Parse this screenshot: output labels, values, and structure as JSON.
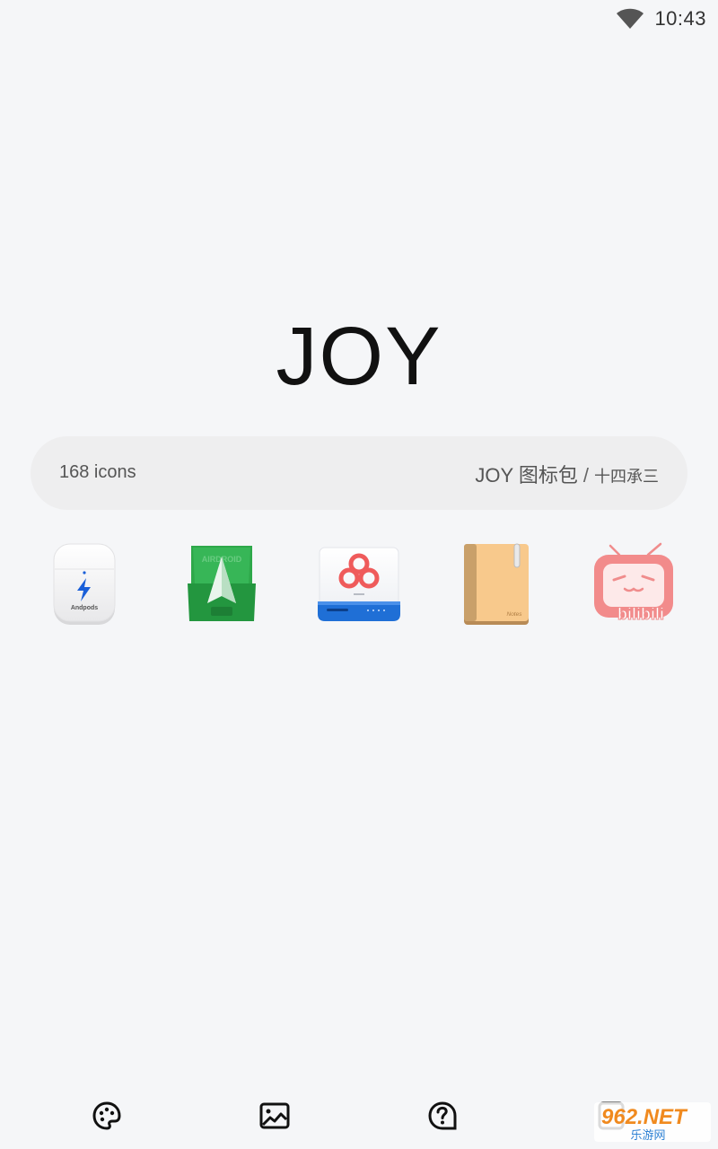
{
  "status_bar": {
    "time": "10:43",
    "wifi_icon": "wifi-icon"
  },
  "title": "JOY",
  "info": {
    "icon_count": "168 icons",
    "pack_name": "JOY 图标包",
    "separator": "/",
    "author": "十四承三"
  },
  "preview_icons": [
    {
      "name": "airpods-icon",
      "label": "Andpods"
    },
    {
      "name": "airdroid-icon",
      "label": "AIRDROID"
    },
    {
      "name": "baidu-netdisk-icon",
      "label": ""
    },
    {
      "name": "notes-icon",
      "label": "Notes"
    },
    {
      "name": "bilibili-icon",
      "label": "bilibili"
    }
  ],
  "bottom_nav": [
    {
      "name": "theme-palette-icon"
    },
    {
      "name": "wallpaper-icon"
    },
    {
      "name": "help-icon"
    },
    {
      "name": "apply-icon"
    }
  ],
  "watermark": {
    "text_top": "962.NET",
    "text_bottom": "乐游网"
  },
  "colors": {
    "background": "#f5f6f8",
    "pill": "#eeeeef",
    "text_primary": "#111111",
    "text_secondary": "#555555"
  }
}
